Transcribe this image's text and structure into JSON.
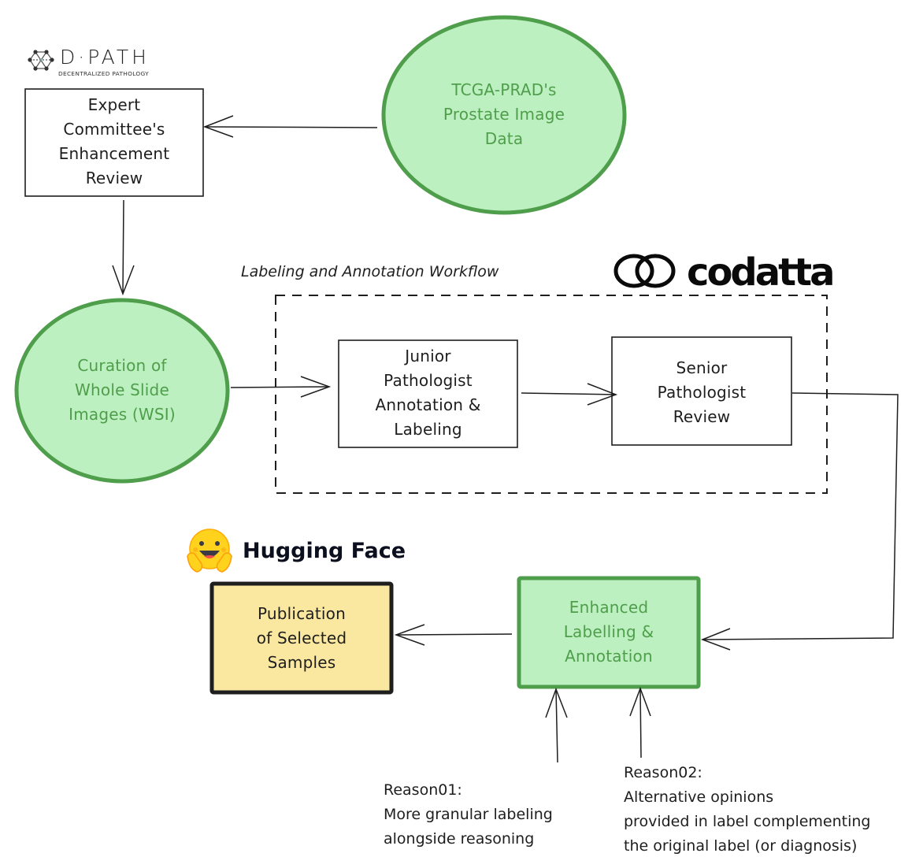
{
  "diagram": {
    "colors": {
      "green_fill": "#bdf0c0",
      "green_stroke": "#4f9e4b",
      "green_text": "#4f9e4b",
      "yellow_fill": "#fbe8a0",
      "ink": "#1e1e1e"
    },
    "nodes": {
      "tcga": {
        "text": "TCGA-PRAD's\nProstate Image\nData",
        "shape": "ellipse",
        "style": "green"
      },
      "expert": {
        "text": "Expert\nCommittee's\nEnhancement\nReview",
        "shape": "rectangle",
        "style": "plain"
      },
      "curation": {
        "text": "Curation of\nWhole Slide\nImages (WSI)",
        "shape": "ellipse",
        "style": "green"
      },
      "junior": {
        "text": "Junior\nPathologist\nAnnotation &\nLabeling",
        "shape": "rectangle",
        "style": "plain"
      },
      "senior": {
        "text": "Senior\nPathologist\nReview",
        "shape": "rectangle",
        "style": "plain"
      },
      "enhanced": {
        "text": "Enhanced\nLabelling &\nAnnotation",
        "shape": "rectangle",
        "style": "green-bold"
      },
      "publication": {
        "text": "Publication\nof Selected\nSamples",
        "shape": "rectangle",
        "style": "yellow-bold"
      }
    },
    "group": {
      "label": "Labeling and Annotation Workflow",
      "style": "dashed"
    },
    "notes": {
      "reason01": "Reason01:\nMore granular labeling\nalongside reasoning",
      "reason02": "Reason02:\nAlternative opinions\nprovided in label complementing\nthe original label (or diagnosis)"
    },
    "edges": [
      {
        "from": "tcga",
        "to": "expert"
      },
      {
        "from": "expert",
        "to": "curation"
      },
      {
        "from": "curation",
        "to": "junior"
      },
      {
        "from": "junior",
        "to": "senior"
      },
      {
        "from": "senior",
        "to": "enhanced"
      },
      {
        "from": "enhanced",
        "to": "publication"
      },
      {
        "from": "reason01",
        "to": "enhanced"
      },
      {
        "from": "reason02",
        "to": "enhanced"
      }
    ],
    "logos": {
      "dpath": {
        "name": "D·PATH",
        "tagline": "DECENTRALIZED PATHOLOGY"
      },
      "codatta": {
        "name": "codatta"
      },
      "huggingface": {
        "name": "Hugging Face",
        "icon": "hugging-face-emoji-icon"
      }
    }
  }
}
